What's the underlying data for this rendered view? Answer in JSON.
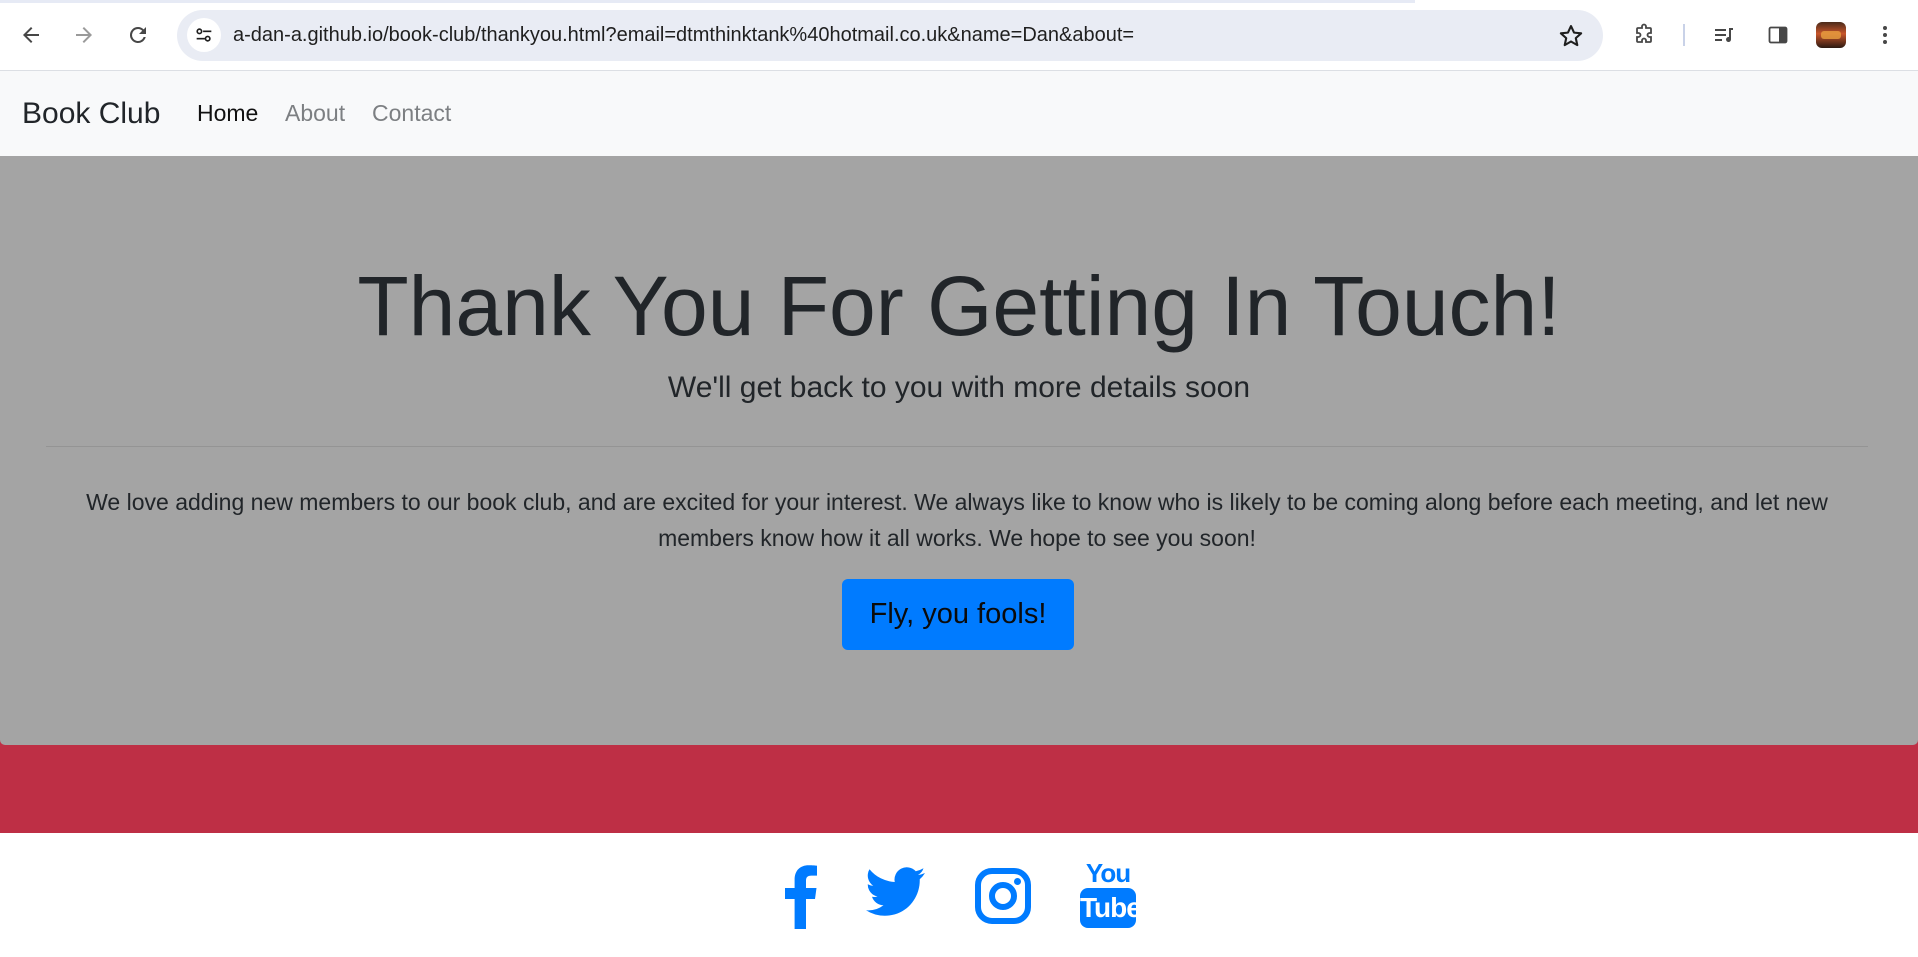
{
  "browser": {
    "url": "a-dan-a.github.io/book-club/thankyou.html?email=dtmthinktank%40hotmail.co.uk&name=Dan&about=",
    "icons": {
      "back": "back-arrow-icon",
      "forward": "forward-arrow-icon",
      "reload": "reload-icon",
      "site_info": "site-info-icon",
      "bookmark": "star-icon",
      "extensions": "puzzle-icon",
      "media": "media-queue-icon",
      "side_panel": "side-panel-icon",
      "menu": "kebab-menu-icon"
    }
  },
  "navbar": {
    "brand": "Book Club",
    "links": [
      {
        "label": "Home",
        "active": true
      },
      {
        "label": "About",
        "active": false
      },
      {
        "label": "Contact",
        "active": false
      }
    ]
  },
  "hero": {
    "title": "Thank You For Getting In Touch!",
    "subtitle": "We'll get back to you with more details soon",
    "body_line1": "We love adding new members to our book club, and are excited for your interest. We always like to know who is likely to be coming along before each meeting, and let new",
    "body_line2": "members know how it all works. We hope to see you soon!",
    "button_label": "Fly, you fools!"
  },
  "footer": {
    "social": [
      {
        "name": "facebook-icon"
      },
      {
        "name": "twitter-icon"
      },
      {
        "name": "instagram-icon"
      },
      {
        "name": "youtube-icon",
        "text_top": "You",
        "text_bottom": "Tube"
      }
    ]
  },
  "colors": {
    "band": "#be2f45",
    "jumbotron": "#a4a4a4",
    "primary": "#007bff",
    "navbar_bg": "#f8f9fa"
  }
}
